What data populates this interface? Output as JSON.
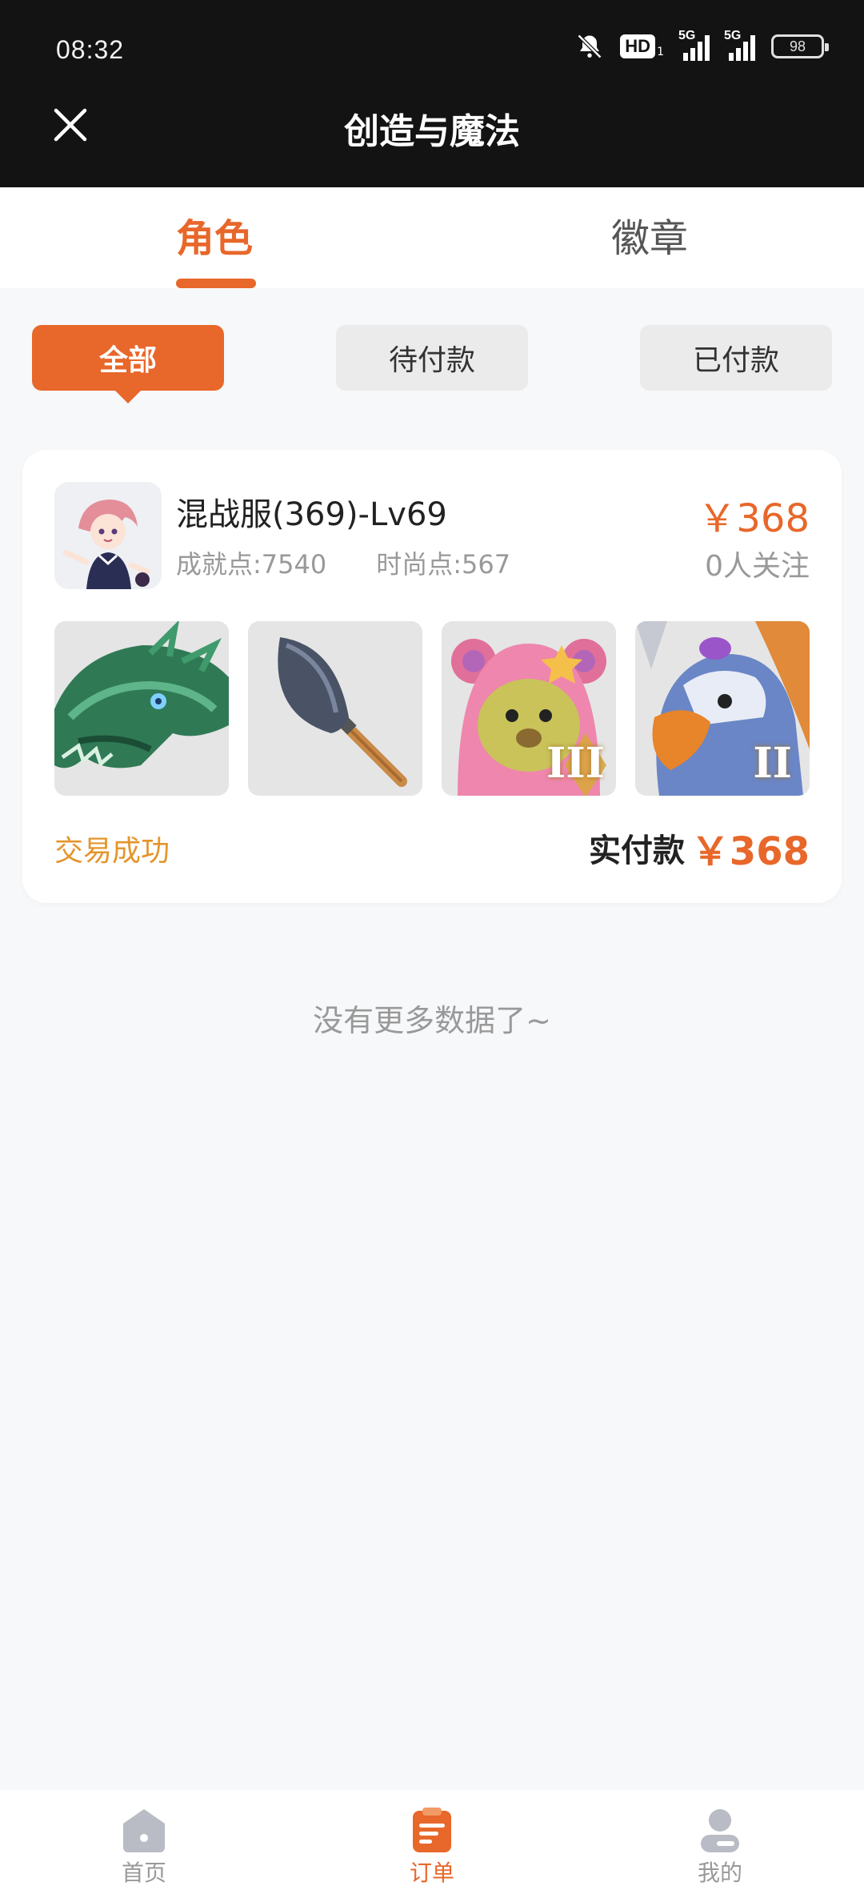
{
  "status_bar": {
    "time": "08:32",
    "hd": "HD",
    "hd_sub": "1",
    "net1": "5G",
    "net2": "5G",
    "battery": "98",
    "icons": [
      "bell-off-icon",
      "hd-icon",
      "signal-icon",
      "signal-icon",
      "battery-icon"
    ]
  },
  "header": {
    "title": "创造与魔法",
    "close_icon": "close-icon"
  },
  "tabs": [
    {
      "label": "角色",
      "active": true
    },
    {
      "label": "徽章",
      "active": false
    }
  ],
  "filters": [
    {
      "label": "全部",
      "active": true
    },
    {
      "label": "待付款",
      "active": false
    },
    {
      "label": "已付款",
      "active": false
    }
  ],
  "order": {
    "name": "混战服(369)-Lv69",
    "achievement": "成就点:7540",
    "fashion": "时尚点:567",
    "price": "￥368",
    "followers": "0人关注",
    "items": [
      {
        "icon": "green-dragon-mount-icon"
      },
      {
        "icon": "shovel-icon"
      },
      {
        "icon": "pink-bear-pet-icon",
        "tier": "III"
      },
      {
        "icon": "eagle-mount-icon",
        "tier": "II"
      }
    ],
    "status": "交易成功",
    "paid_label": "实付款",
    "paid_amount": "￥368"
  },
  "footer_note": "没有更多数据了~",
  "bottom_nav": [
    {
      "label": "首页",
      "icon": "home-icon",
      "active": false
    },
    {
      "label": "订单",
      "icon": "order-icon",
      "active": true
    },
    {
      "label": "我的",
      "icon": "profile-icon",
      "active": false
    }
  ],
  "colors": {
    "accent": "#e8672a",
    "status_success": "#e4952c",
    "header_bg": "#131313",
    "page_bg": "#f7f8fa"
  }
}
